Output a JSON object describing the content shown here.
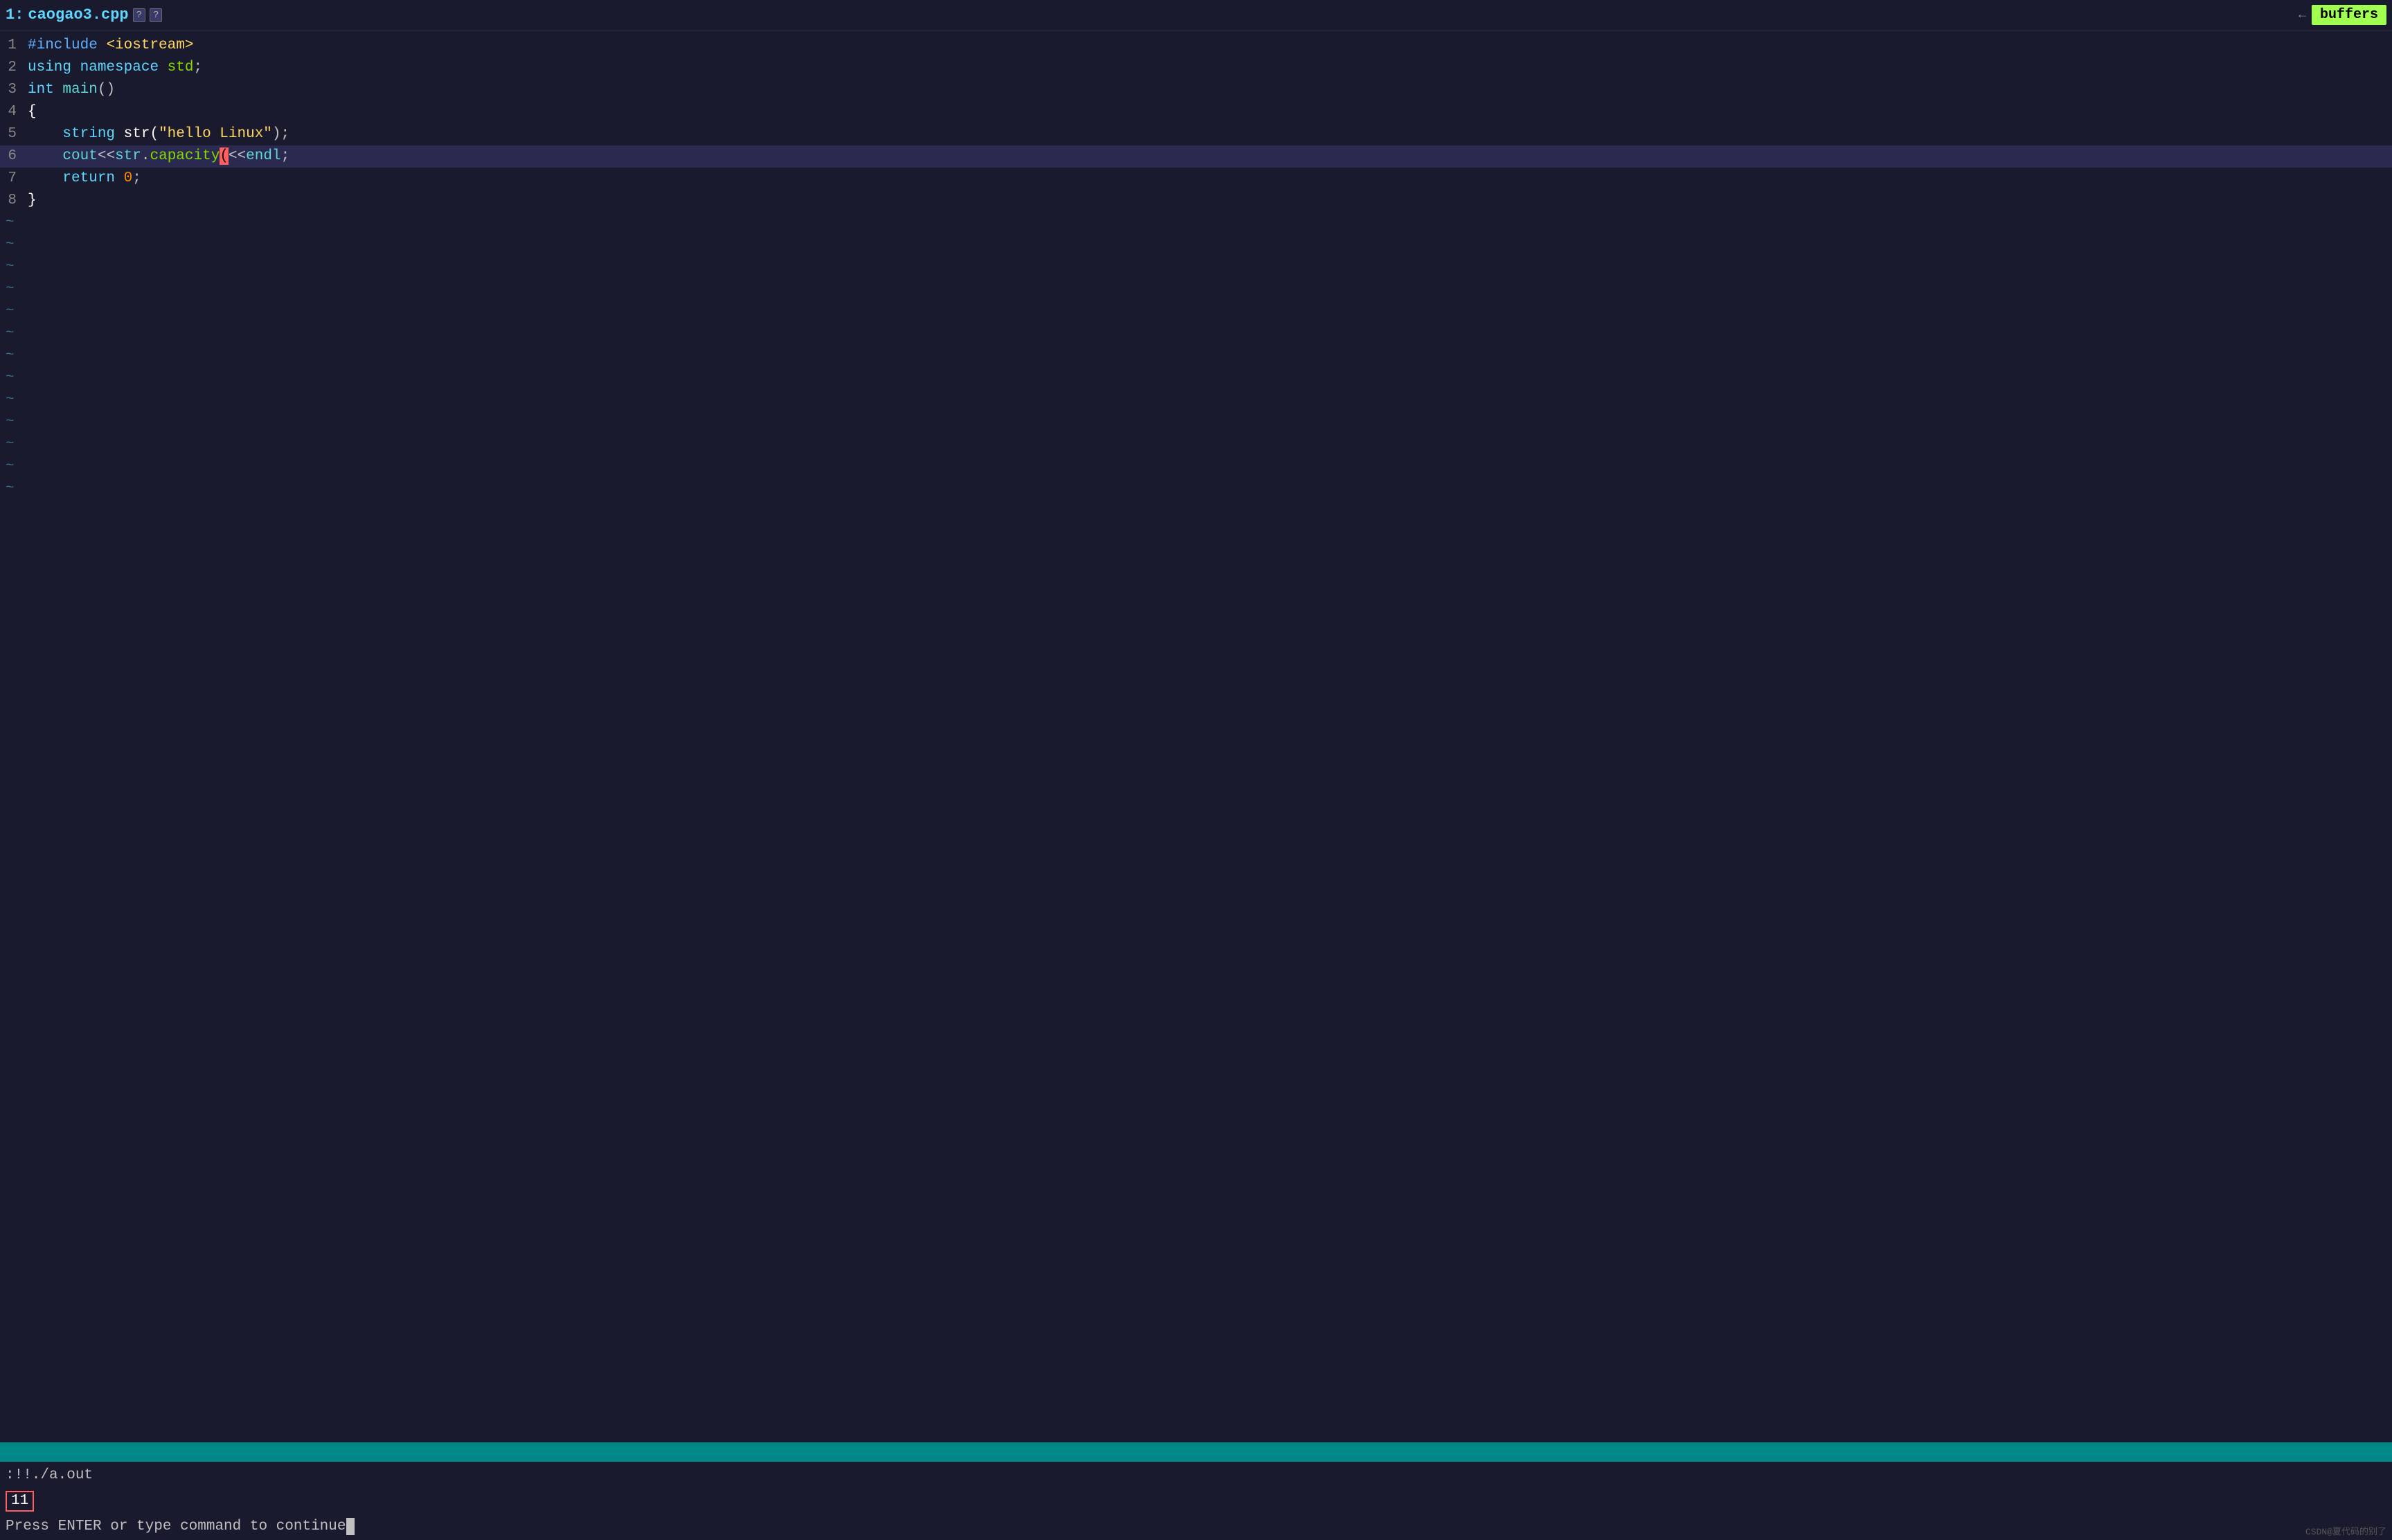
{
  "tab": {
    "number": "1:",
    "filename": "caogao3.cpp",
    "icon1": "?",
    "icon2": "?",
    "buffers_label": "buffers"
  },
  "code": {
    "lines": [
      {
        "num": "1",
        "content_html": "<span class='kw-include'>#include</span> <span class='str-color'>&lt;iostream&gt;</span>"
      },
      {
        "num": "2",
        "content_html": "<span class='kw-blue'>using</span> <span class='kw-blue'>namespace</span> <span class='kw-green'>std</span>;"
      },
      {
        "num": "3",
        "content_html": "<span class='kw-blue'>int</span> <span class='teal'>main</span>()"
      },
      {
        "num": "4",
        "content_html": "<span class='white'>{</span>"
      },
      {
        "num": "5",
        "content_html": "    <span class='kw-blue'>string</span> <span class='white'>str(</span><span class='str-color'>\"hello Linux\"</span>);"
      },
      {
        "num": "6",
        "content_html": "    <span class='teal'>cout</span>&lt;&lt;<span class='teal'>str</span>.<span class='kw-green'>capacity</span><span class='cursor-box'>(<br/></span>)&lt;&lt;<span class='teal'>endl</span>;",
        "highlighted": true
      },
      {
        "num": "7",
        "content_html": "    <span class='kw-blue'>return</span> <span class='orange'>0</span>;"
      },
      {
        "num": "8",
        "content_html": "<span class='white'>}</span>"
      }
    ],
    "tildes": 13
  },
  "terminal": {
    "cmd": ":!!./a.out",
    "output": "11",
    "press_text": "Press ENTER or type command to continue"
  },
  "watermark": "CSDN@夏代码的别了"
}
